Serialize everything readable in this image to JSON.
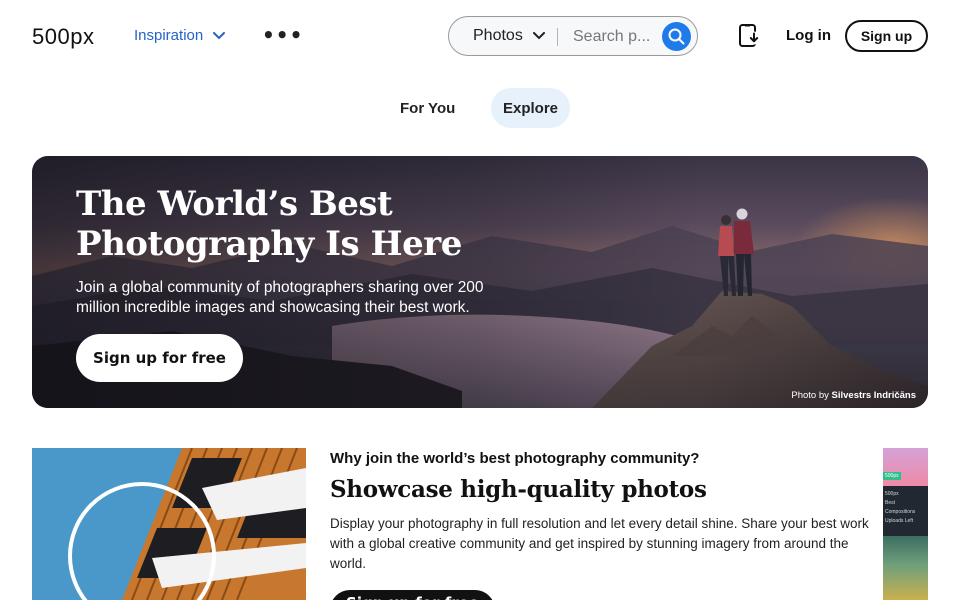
{
  "header": {
    "logo": "500px",
    "nav_inspiration": "Inspiration",
    "more_label": "•••",
    "search": {
      "type_selected": "Photos",
      "placeholder": "Search p..."
    },
    "login_label": "Log in",
    "signup_label": "Sign up"
  },
  "tabs": [
    {
      "label": "For You",
      "active": false
    },
    {
      "label": "Explore",
      "active": true
    }
  ],
  "hero": {
    "title_line1": "The World’s Best",
    "title_line2": "Photography Is Here",
    "subtitle": "Join a global community of photographers sharing over 200 million incredible images and showcasing their best work.",
    "cta_label": "Sign up for free",
    "credit_prefix": "Photo by",
    "credit_name": "Silvestrs Indričāns"
  },
  "feature": {
    "kicker": "Why join the world’s best photography community?",
    "title": "Showcase high-quality photos",
    "text": "Display your photography in full resolution and let every detail shine. Share your best work with a global creative community and get inspired by stunning imagery from around the world.",
    "cta_label": "Sign up for free"
  },
  "side_thumb": {
    "tag": "500px",
    "line1": "500px",
    "line2": "Best Compositions",
    "line3": "Uploads Left"
  },
  "colors": {
    "accent": "#1e7be8",
    "link": "#2563c9",
    "active_tab_bg": "#e6f1fb"
  }
}
